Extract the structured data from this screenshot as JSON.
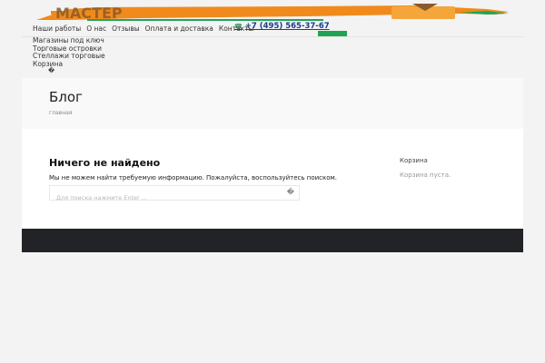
{
  "header": {
    "logo_alt": "Мастер",
    "nav": [
      "Наши работы",
      "О нас",
      "Отзывы",
      "Оплата и доставка",
      "Контакты"
    ],
    "phone": "+7 (495) 565-37-67",
    "submenu": [
      "Магазины под ключ",
      "Торговые островки",
      "Стеллажи торговые",
      "Корзина"
    ],
    "colors": {
      "orange": "#f08a1c",
      "green": "#1fa456",
      "brown": "#8b5a2b"
    }
  },
  "banner": {
    "title": "Блог",
    "breadcrumb": "главная"
  },
  "main": {
    "title": "Ничего не найдено",
    "text": "Мы не можем найти требуемую информацию. Пожалуйста, воспользуйтесь поиском.",
    "search_placeholder": "Для поиска нажмите Enter ..."
  },
  "sidebar": {
    "cart_title": "Корзина",
    "cart_empty": "Корзина пуста."
  }
}
